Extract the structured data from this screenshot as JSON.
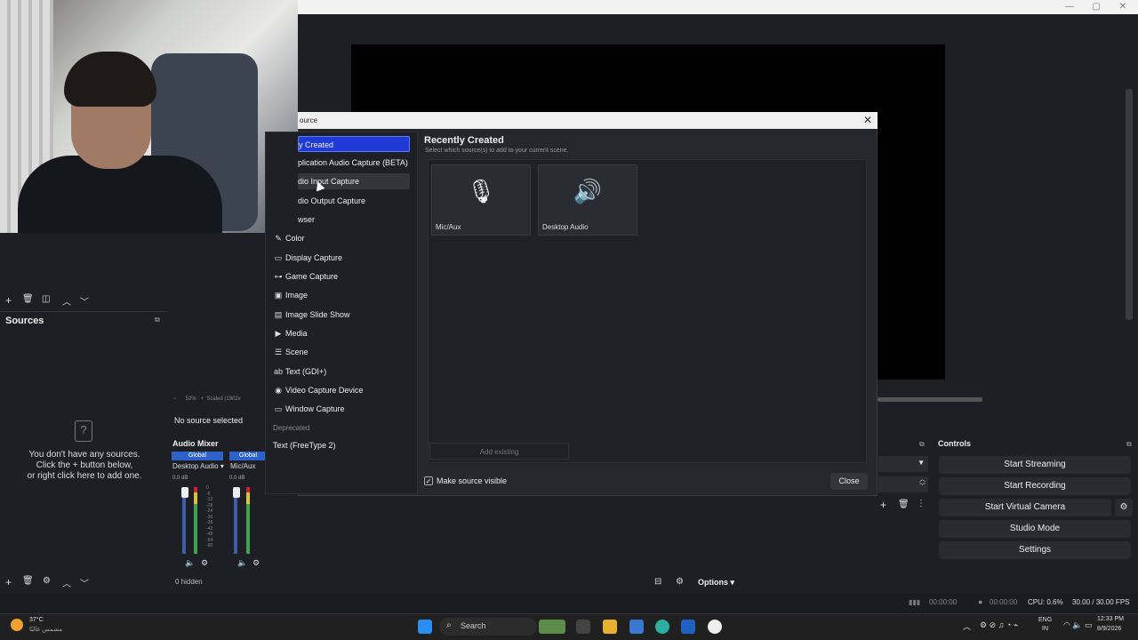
{
  "window": {
    "title_buttons": [
      "—",
      "▢",
      "✕"
    ]
  },
  "sources_dock": {
    "header": "Sources",
    "empty_icon": "?",
    "empty_text": "You don't have any sources.\nClick the + button below,\nor right click here to add one.",
    "toolbar_icons": [
      "plus-icon",
      "trash-icon",
      "filter-icon",
      "chevron-up-icon",
      "chevron-down-icon"
    ]
  },
  "scene_toolbar_icons": [
    "plus-icon",
    "trash-icon",
    "filter-icon",
    "chevron-up-icon",
    "chevron-down-icon"
  ],
  "preview_bar": {
    "zoom": "52%",
    "scaled": "Scaled (1902x"
  },
  "no_source_selected": "No source selected",
  "audio_mixer": {
    "header": "Audio Mixer",
    "channels": [
      {
        "name": "Desktop Audio",
        "tag": "Global",
        "db": "0.0 dB"
      },
      {
        "name": "Mic/Aux",
        "tag": "Global",
        "db": "0.0 dB"
      }
    ],
    "scale": [
      "0",
      "-6",
      "-12",
      "-18",
      "-24",
      "-30",
      "-36",
      "-42",
      "-48",
      "-54",
      "-60"
    ],
    "hidden_count": "0 hidden"
  },
  "bottom_options": {
    "label": "Options"
  },
  "controls": {
    "header": "Controls",
    "buttons": [
      "Start Streaming",
      "Start Recording",
      "Start Virtual Camera",
      "Studio Mode",
      "Settings"
    ]
  },
  "status": {
    "stream_time": "00:00:00",
    "record_time": "00:00:00",
    "cpu": "CPU: 0.6%",
    "fps": "30.00 / 30.00 FPS"
  },
  "dialog": {
    "title": "ource",
    "close": "✕",
    "list": [
      {
        "label": "y Created",
        "icon": ""
      },
      {
        "label": "plication Audio Capture (BETA)",
        "icon": ""
      },
      {
        "label": "dio Input Capture",
        "icon": ""
      },
      {
        "label": "dio Output Capture",
        "icon": ""
      },
      {
        "label": "wser",
        "icon": ""
      },
      {
        "label": "Color",
        "icon": "✎"
      },
      {
        "label": "Display Capture",
        "icon": "▭"
      },
      {
        "label": "Game Capture",
        "icon": "⊶"
      },
      {
        "label": "Image",
        "icon": "▣"
      },
      {
        "label": "Image Slide Show",
        "icon": "▤"
      },
      {
        "label": "Media",
        "icon": "▶"
      },
      {
        "label": "Scene",
        "icon": "☰"
      },
      {
        "label": "Text (GDI+)",
        "icon": "ab"
      },
      {
        "label": "Video Capture Device",
        "icon": "◉"
      },
      {
        "label": "Window Capture",
        "icon": "▭"
      }
    ],
    "deprecated_header": "Deprecated",
    "deprecated_item": "Text (FreeType 2)",
    "recent_title": "Recently Created",
    "recent_subtitle": "Select which source(s) to add to your current scene.",
    "tiles": [
      {
        "label": "Mic/Aux",
        "icon": "microphone-icon"
      },
      {
        "label": "Desktop Audio",
        "icon": "speaker-icon"
      }
    ],
    "add_existing": "Add existing",
    "make_visible": "Make source visible",
    "close_button": "Close"
  },
  "taskbar": {
    "weather_temp": "37°C",
    "weather_desc": "مشمس غالبًا",
    "search": "Search",
    "lang": "ENG",
    "region": "IN",
    "time": "12:33 PM",
    "date": "8/9/2026"
  }
}
